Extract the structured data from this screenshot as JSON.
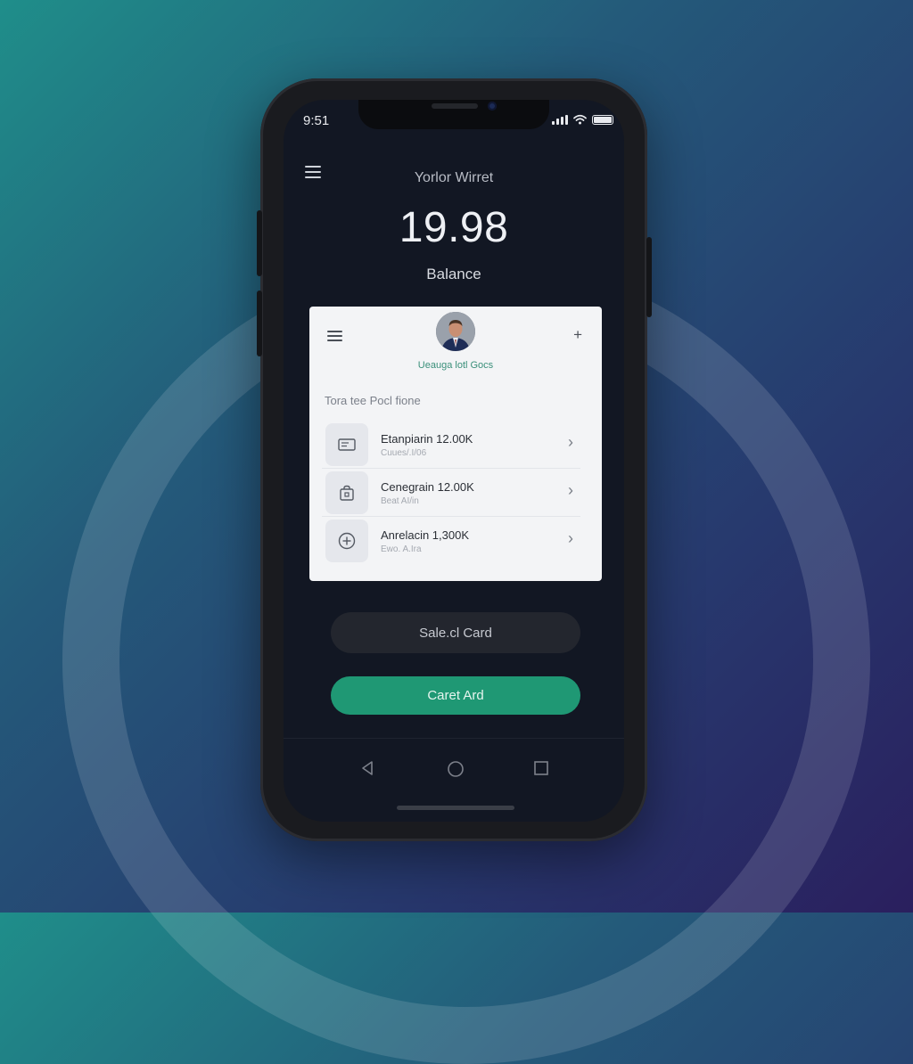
{
  "status_bar": {
    "time": "9:51"
  },
  "header": {
    "title": "Yorlor Wirret",
    "balance_amount": "19.98",
    "balance_label": "Balance"
  },
  "card": {
    "name": "Ueauga lotl Gocs",
    "section_label": "Tora tee Pocl fione",
    "items": [
      {
        "title": "Etanpiarin 12.00K",
        "subtitle": "Cuues/.I/06",
        "icon": "card-icon"
      },
      {
        "title": "Cenegrain 12.00K",
        "subtitle": "Beat AI/in",
        "icon": "bag-icon"
      },
      {
        "title": "Anrelacin 1,300K",
        "subtitle": "Ewo. A.Ira",
        "icon": "plus-circle-icon"
      }
    ]
  },
  "buttons": {
    "select_card": "Sale.cl Card",
    "create_card": "Caret Ard"
  },
  "colors": {
    "accent": "#1f9874",
    "screen_bg": "#121723",
    "card_bg": "#f3f4f6"
  }
}
